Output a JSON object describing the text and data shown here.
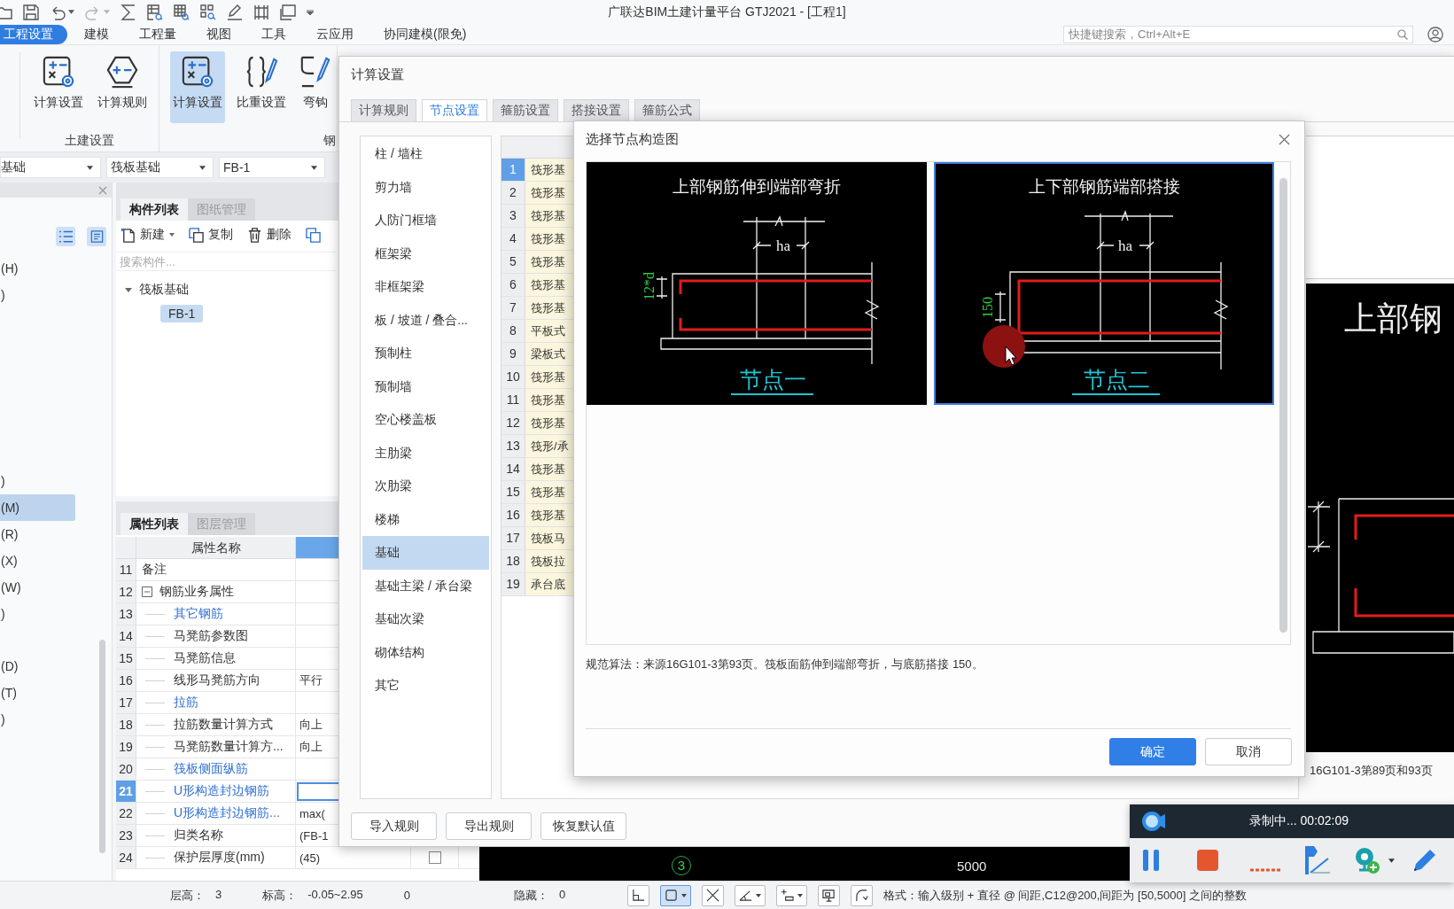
{
  "window": {
    "title": "广联达BIM土建计量平台 GTJ2021 - [工程1]"
  },
  "menu": [
    {
      "label": "工程设置",
      "selected": true
    },
    {
      "label": "建模",
      "selected": false
    },
    {
      "label": "工程量",
      "selected": false
    },
    {
      "label": "视图",
      "selected": false
    },
    {
      "label": "工具",
      "selected": false
    },
    {
      "label": "云应用",
      "selected": false
    },
    {
      "label": "协同建模(限免)",
      "selected": false
    }
  ],
  "search": {
    "placeholder": "快捷键搜索，Ctrl+Alt+E"
  },
  "ribbon": [
    {
      "label": "土建设置",
      "buttons": [
        {
          "label": "计算设置",
          "kind": "calc",
          "selected": false
        },
        {
          "label": "计算规则",
          "kind": "rules",
          "selected": false
        }
      ]
    },
    {
      "label": "钢",
      "buttons": [
        {
          "label": "计算设置",
          "kind": "calc",
          "selected": true
        },
        {
          "label": "比重设置",
          "kind": "weight",
          "selected": false
        },
        {
          "label": "弯钩",
          "kind": "hook",
          "selected": false
        }
      ]
    }
  ],
  "selectors": [
    {
      "value": "基础"
    },
    {
      "value": "筏板基础"
    },
    {
      "value": "FB-1"
    }
  ],
  "nav_panel": {
    "groups": [
      {
        "items": [
          {
            "label": "(H)",
            "selected": false
          },
          {
            "label": ")",
            "selected": false
          }
        ]
      },
      {
        "items": [
          {
            "label": ")",
            "selected": false
          },
          {
            "label": "(M)",
            "selected": true
          },
          {
            "label": "(R)",
            "selected": false
          },
          {
            "label": "(X)",
            "selected": false
          },
          {
            "label": "(W)",
            "selected": false
          },
          {
            "label": ")",
            "selected": false
          }
        ]
      },
      {
        "items": [
          {
            "label": "(D)",
            "selected": false
          },
          {
            "label": "(T)",
            "selected": false
          },
          {
            "label": ")",
            "selected": false
          }
        ]
      }
    ]
  },
  "component_panel": {
    "tabs": [
      {
        "label": "构件列表",
        "selected": true
      },
      {
        "label": "图纸管理",
        "selected": false
      }
    ],
    "actions": [
      {
        "label": "新建",
        "kind": "new"
      },
      {
        "label": "复制",
        "kind": "copy"
      },
      {
        "label": "删除",
        "kind": "delete"
      }
    ],
    "search": {
      "placeholder": "搜索构件..."
    },
    "tree": [
      {
        "label": "筏板基础",
        "expanded": true,
        "selected": false,
        "children": [
          {
            "label": "FB-1",
            "selected": true
          }
        ]
      }
    ]
  },
  "property_panel": {
    "tabs": [
      {
        "label": "属性列表",
        "selected": true
      },
      {
        "label": "图层管理",
        "selected": false
      }
    ],
    "columns": [
      {
        "label": "属性名称"
      }
    ],
    "rows": [
      {
        "number": "11",
        "name": "备注",
        "kind": "plain",
        "link": false,
        "selected": false
      },
      {
        "number": "12",
        "name": "钢筋业务属性",
        "kind": "group",
        "expanded": true,
        "link": false,
        "selected": false
      },
      {
        "number": "13",
        "name": "其它钢筋",
        "kind": "child",
        "link": true,
        "selected": false
      },
      {
        "number": "14",
        "name": "马凳筋参数图",
        "kind": "child",
        "link": false,
        "selected": false
      },
      {
        "number": "15",
        "name": "马凳筋信息",
        "kind": "child",
        "link": false,
        "selected": false
      },
      {
        "number": "16",
        "name": "线形马凳筋方向",
        "value": "平行",
        "kind": "child",
        "link": false,
        "selected": false
      },
      {
        "number": "17",
        "name": "拉筋",
        "kind": "child",
        "link": true,
        "selected": false
      },
      {
        "number": "18",
        "name": "拉筋数量计算方式",
        "value": "向上",
        "kind": "child",
        "link": false,
        "selected": false
      },
      {
        "number": "19",
        "name": "马凳筋数量计算方...",
        "value": "向上",
        "kind": "child",
        "link": false,
        "selected": false
      },
      {
        "number": "20",
        "name": "筏板侧面纵筋",
        "kind": "child",
        "link": true,
        "selected": false
      },
      {
        "number": "21",
        "name": "U形构造封边钢筋",
        "kind": "child",
        "link": true,
        "selected": true
      },
      {
        "number": "22",
        "name": "U形构造封边钢筋...",
        "value": "max(",
        "kind": "child",
        "link": true,
        "selected": false
      },
      {
        "number": "23",
        "name": "归类名称",
        "value": "(FB-1",
        "kind": "child",
        "link": false,
        "selected": false
      },
      {
        "number": "24",
        "name": "保护层厚度(mm)",
        "value": "(45)",
        "kind": "child",
        "link": false,
        "selected": false,
        "checked": false
      }
    ]
  },
  "canvas": {
    "axis": "3",
    "dimension": "5000"
  },
  "settings_dialog": {
    "title": "计算设置",
    "tabs": [
      {
        "label": "计算规则",
        "selected": false
      },
      {
        "label": "节点设置",
        "selected": true
      },
      {
        "label": "箍筋设置",
        "selected": false
      },
      {
        "label": "搭接设置",
        "selected": false
      },
      {
        "label": "箍筋公式",
        "selected": false
      }
    ],
    "categories": [
      {
        "label": "柱 / 墙柱",
        "selected": false
      },
      {
        "label": "剪力墙",
        "selected": false
      },
      {
        "label": "人防门框墙",
        "selected": false
      },
      {
        "label": "框架梁",
        "selected": false
      },
      {
        "label": "非框架梁",
        "selected": false
      },
      {
        "label": "板 / 坡道 / 叠合...",
        "selected": false
      },
      {
        "label": "预制柱",
        "selected": false
      },
      {
        "label": "预制墙",
        "selected": false
      },
      {
        "label": "空心楼盖板",
        "selected": false
      },
      {
        "label": "主肋梁",
        "selected": false
      },
      {
        "label": "次肋梁",
        "selected": false
      },
      {
        "label": "楼梯",
        "selected": false
      },
      {
        "label": "基础",
        "selected": true
      },
      {
        "label": "基础主梁 / 承台梁",
        "selected": false
      },
      {
        "label": "基础次梁",
        "selected": false
      },
      {
        "label": "砌体结构",
        "selected": false
      },
      {
        "label": "其它",
        "selected": false
      }
    ],
    "node_rows": [
      {
        "number": "1",
        "name": "筏形基",
        "selected": true
      },
      {
        "number": "2",
        "name": "筏形基",
        "selected": false
      },
      {
        "number": "3",
        "name": "筏形基",
        "selected": false
      },
      {
        "number": "4",
        "name": "筏形基",
        "selected": false
      },
      {
        "number": "5",
        "name": "筏形基",
        "selected": false
      },
      {
        "number": "6",
        "name": "筏形基",
        "selected": false
      },
      {
        "number": "7",
        "name": "筏形基",
        "selected": false
      },
      {
        "number": "8",
        "name": "平板式",
        "selected": false
      },
      {
        "number": "9",
        "name": "梁板式",
        "selected": false
      },
      {
        "number": "10",
        "name": "筏形基",
        "selected": false
      },
      {
        "number": "11",
        "name": "筏形基",
        "selected": false
      },
      {
        "number": "12",
        "name": "筏形基",
        "selected": false
      },
      {
        "number": "13",
        "name": "筏形/承",
        "selected": false
      },
      {
        "number": "14",
        "name": "筏形基",
        "selected": false
      },
      {
        "number": "15",
        "name": "筏形基",
        "selected": false
      },
      {
        "number": "16",
        "name": "筏形基",
        "selected": false
      },
      {
        "number": "17",
        "name": "筏板马",
        "selected": false
      },
      {
        "number": "18",
        "name": "筏板拉",
        "selected": false
      },
      {
        "number": "19",
        "name": "承台底",
        "selected": false
      }
    ],
    "preview": {
      "title": "上部钢",
      "caption": "16G101-3第89页和93页"
    },
    "buttons": [
      {
        "label": "导入规则"
      },
      {
        "label": "导出规则"
      },
      {
        "label": "恢复默认值"
      }
    ]
  },
  "node_dialog": {
    "title": "选择节点构造图",
    "nodes": [
      {
        "title": "上部钢筋伸到端部弯折",
        "kind": "bend",
        "anchor": "ha",
        "dimension": "12*d",
        "label": "节点一",
        "selected": false
      },
      {
        "title": "上下部钢筋端部搭接",
        "kind": "lap",
        "anchor": "ha",
        "dimension": "150",
        "label": "节点二",
        "selected": true
      }
    ],
    "description": "规范算法：来源16G101-3第93页。筏板面筋伸到端部弯折，与底筋搭接 150。",
    "buttons": [
      {
        "label": "确定",
        "kind": "primary"
      },
      {
        "label": "取消",
        "kind": "secondary"
      }
    ]
  },
  "status_bar": {
    "fields": [
      {
        "label": "层高：",
        "value": "3"
      },
      {
        "label": "标高：",
        "value": "-0.05~2.95"
      },
      {
        "value": "0"
      },
      {
        "label": "隐藏：",
        "value": "0"
      }
    ],
    "tools": [
      {
        "kind": "ortho",
        "selected": false,
        "dropdown": false
      },
      {
        "kind": "snap",
        "selected": true,
        "dropdown": true
      },
      {
        "kind": "cross",
        "selected": false,
        "dropdown": false
      },
      {
        "kind": "angle",
        "selected": false,
        "dropdown": true
      },
      {
        "kind": "offset",
        "selected": false,
        "dropdown": true
      },
      {
        "kind": "display",
        "selected": false,
        "dropdown": false
      },
      {
        "kind": "arc",
        "selected": false,
        "dropdown": false
      }
    ],
    "hint": "格式：输入级别 + 直径 @ 间距,C12@200,间距为 [50,5000] 之间的整数"
  },
  "recorder": {
    "status": "录制中... 00:02:09"
  }
}
